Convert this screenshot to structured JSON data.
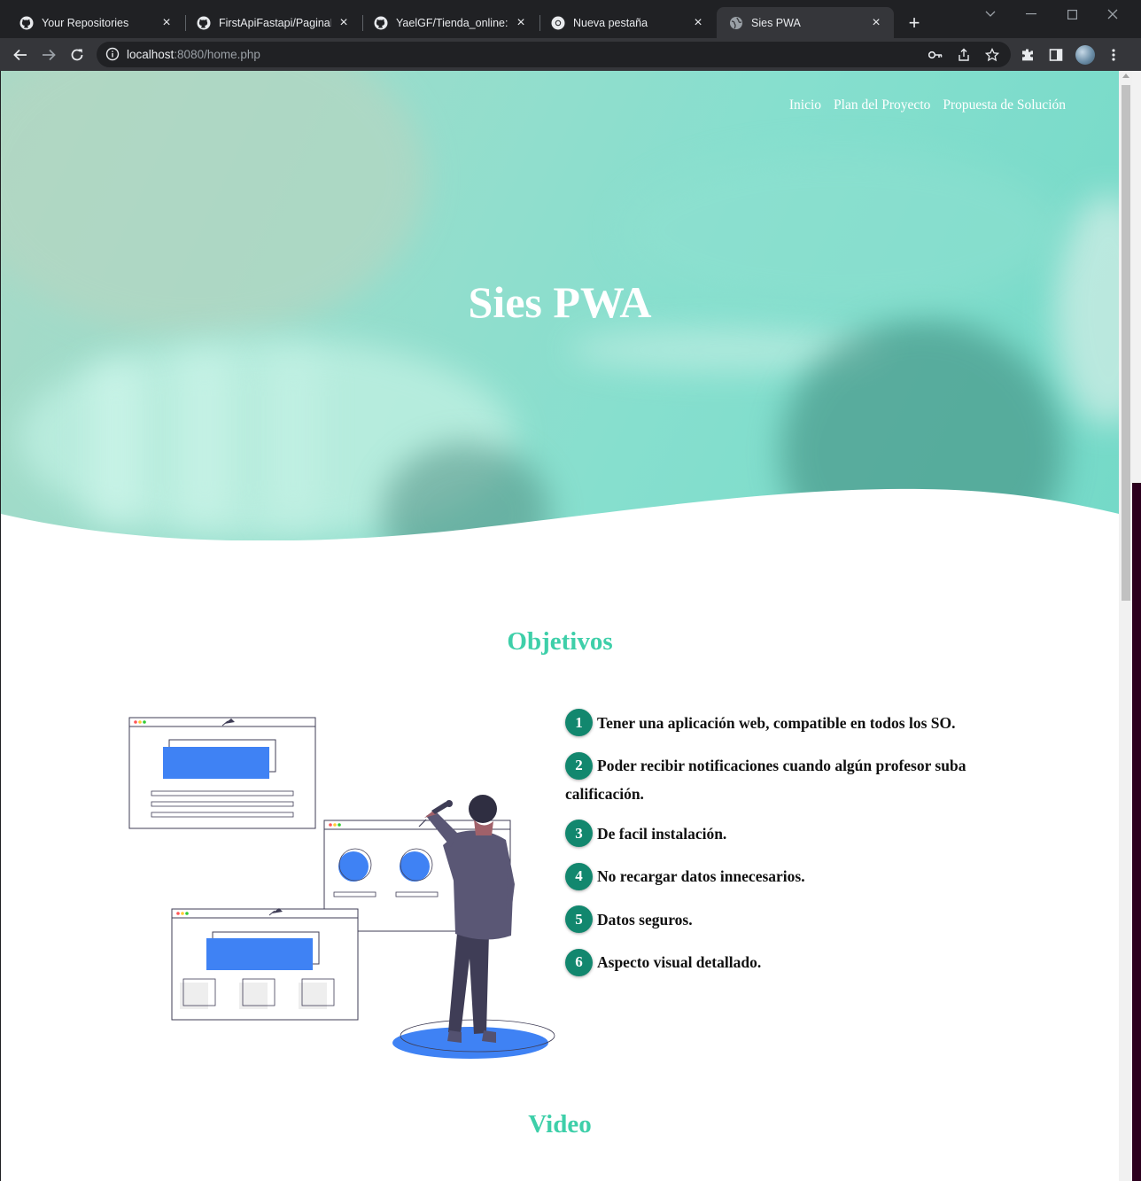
{
  "browser": {
    "tabs": [
      {
        "title": "Your Repositories",
        "icon": "github-icon"
      },
      {
        "title": "FirstApiFastapi/PaginaFastapi",
        "icon": "github-icon"
      },
      {
        "title": "YaelGF/Tienda_online: Des",
        "icon": "github-icon"
      },
      {
        "title": "Nueva pestaña",
        "icon": "chrome-icon"
      },
      {
        "title": "Sies PWA",
        "icon": "globe-icon",
        "active": true
      }
    ],
    "url_host": "localhost",
    "url_rest": ":8080/home.php"
  },
  "page": {
    "nav": [
      "Inicio",
      "Plan del Proyecto",
      "Propuesta de Solución"
    ],
    "hero_title": "Sies PWA",
    "objectives_title": "Objetivos",
    "objectives": [
      {
        "n": "1",
        "text": "Tener una aplicación web, compatible en todos los SO."
      },
      {
        "n": "2",
        "text": "Poder recibir notificaciones cuando algún profesor suba calificación."
      },
      {
        "n": "3",
        "text": "De facil instalación."
      },
      {
        "n": "4",
        "text": "No recargar datos innecesarios."
      },
      {
        "n": "5",
        "text": "Datos seguros."
      },
      {
        "n": "6",
        "text": "Aspecto visual detallado."
      }
    ],
    "video_title": "Video"
  },
  "colors": {
    "accent": "#3ecfa9",
    "badge": "#12876e",
    "illustration_blue": "#3f82f4"
  }
}
